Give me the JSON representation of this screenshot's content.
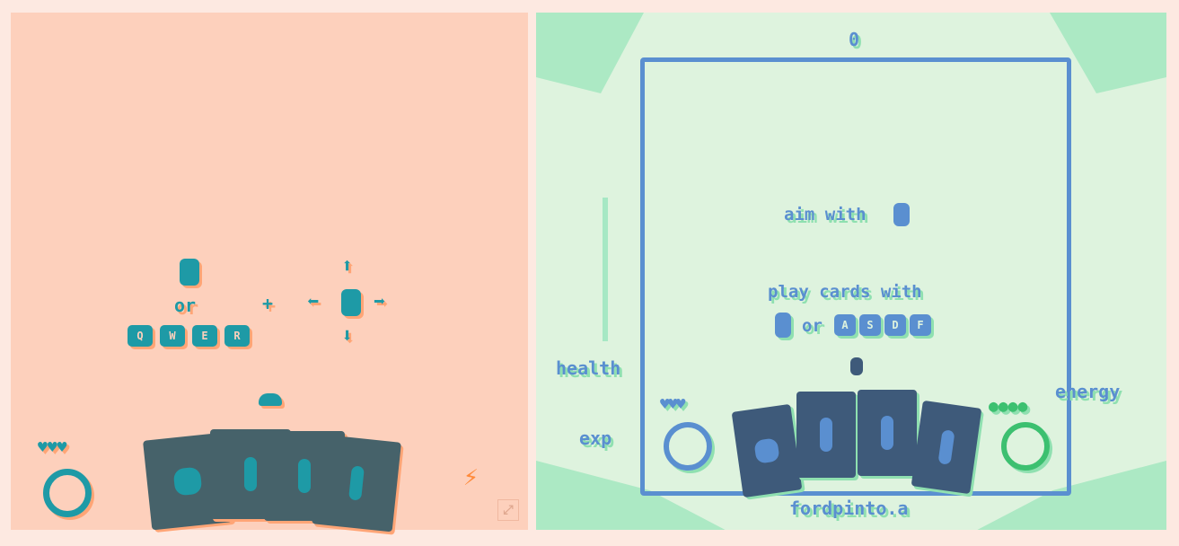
{
  "left_panel": {
    "or_label": "or",
    "plus_label": "+",
    "keys": [
      "Q",
      "W",
      "E",
      "R"
    ],
    "hearts": "♥♥♥",
    "colors": {
      "background": "#fdd0bc",
      "accent": "#1e9aa6",
      "shadow": "#ffa576",
      "card": "#46626a"
    }
  },
  "right_panel": {
    "score": "0",
    "aim_label": "aim with",
    "play_label": "play cards with",
    "or_label": "or",
    "keys": [
      "A",
      "S",
      "D",
      "F"
    ],
    "health_label": "health",
    "exp_label": "exp",
    "energy_label": "energy",
    "hearts": "♥♥♥",
    "energy_pips": "●●●●",
    "author": "fordpinto.a",
    "colors": {
      "background": "#def3de",
      "accent": "#5a8fd0",
      "shadow": "#8fe0b0",
      "card": "#3e5a7a",
      "energy": "#3cc070"
    }
  }
}
